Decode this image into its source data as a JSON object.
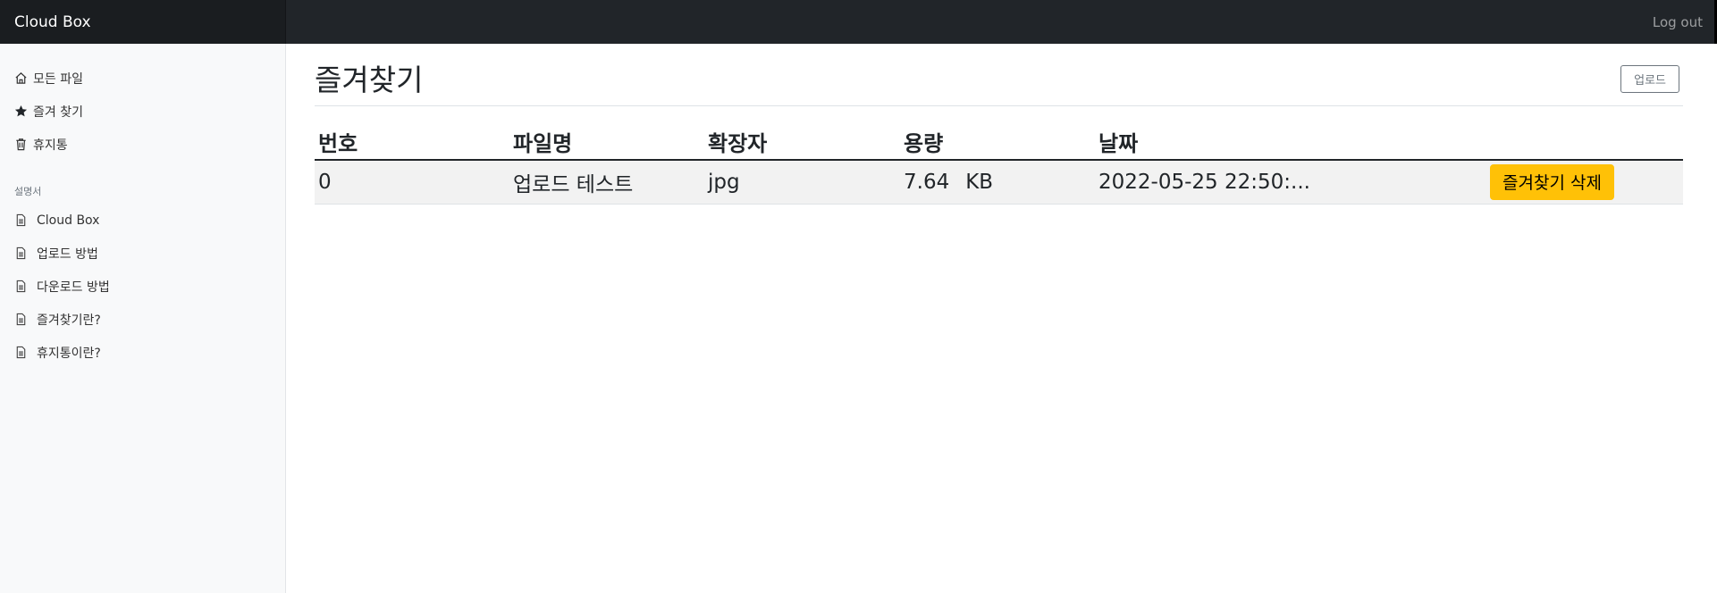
{
  "navbar": {
    "brand": "Cloud Box",
    "logout_label": "Log out"
  },
  "sidebar": {
    "items": [
      {
        "label": "모든 파일",
        "icon": "home-icon"
      },
      {
        "label": "즐겨 찾기",
        "icon": "star-icon"
      },
      {
        "label": "휴지통",
        "icon": "trash-icon"
      }
    ],
    "section_heading": "설명서",
    "docs": [
      {
        "label": "Cloud Box",
        "icon": "file-text-icon"
      },
      {
        "label": "업로드 방법",
        "icon": "file-text-icon"
      },
      {
        "label": "다운로드 방법",
        "icon": "file-text-icon"
      },
      {
        "label": "즐겨찾기란?",
        "icon": "file-text-icon"
      },
      {
        "label": "휴지통이란?",
        "icon": "file-text-icon"
      }
    ]
  },
  "main": {
    "title": "즐겨찾기",
    "upload_label": "업로드"
  },
  "table": {
    "headers": [
      "번호",
      "파일명",
      "확장자",
      "용량",
      "날짜"
    ],
    "rows": [
      {
        "number": "0",
        "filename": "업로드 테스트",
        "extension": "jpg",
        "size": "7.64",
        "size_unit": "KB",
        "date": "2022-05-25 22:50:...",
        "action_label": "즐겨찾기 삭제"
      }
    ]
  },
  "colors": {
    "navbar_bg": "#212529",
    "sidebar_bg": "#f8f9fa",
    "warning_button": "#ffc107"
  }
}
